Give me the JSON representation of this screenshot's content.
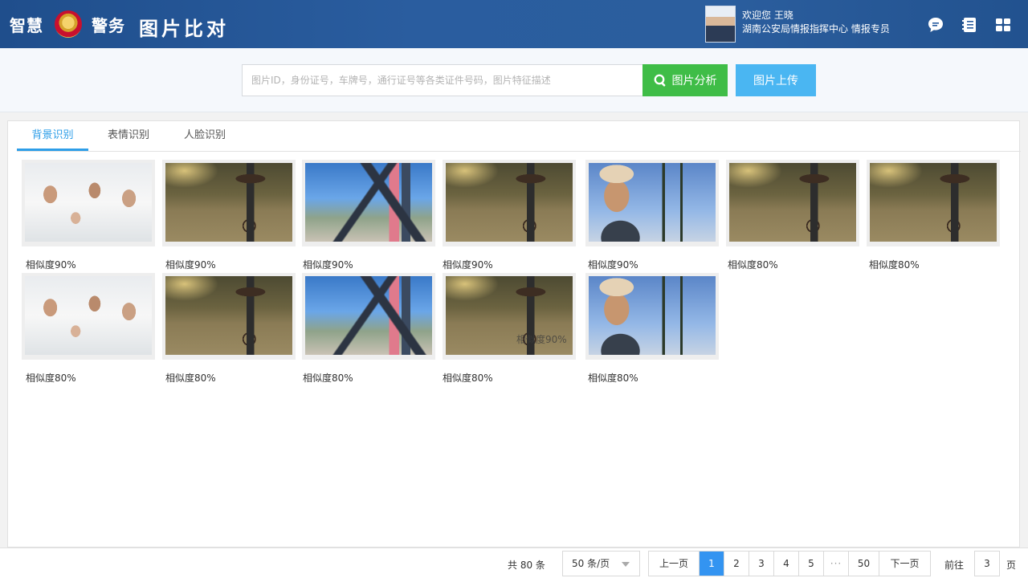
{
  "header": {
    "brand_left": "智慧",
    "brand_right": "警务",
    "app_title": "图片比对",
    "user_greeting": "欢迎您 王晓",
    "user_org": "湖南公安局情报指挥中心 情报专员",
    "icons": [
      "chat-icon",
      "notebook-icon",
      "apps-grid-icon"
    ]
  },
  "search": {
    "placeholder": "图片ID，身份证号，车牌号，通行证号等各类证件号码，图片特征描述",
    "value": "",
    "analyze_label": "图片分析",
    "upload_label": "图片上传"
  },
  "tabs": [
    {
      "label": "背景识别",
      "active": true
    },
    {
      "label": "表情识别",
      "active": false
    },
    {
      "label": "人脸识别",
      "active": false
    }
  ],
  "results": [
    {
      "image": "party-crowd",
      "similarity": "相似度90%"
    },
    {
      "image": "rain-umbrella-bike",
      "similarity": "相似度90%"
    },
    {
      "image": "bridge-couple",
      "similarity": "相似度90%"
    },
    {
      "image": "rain-umbrella-bike",
      "similarity": "相似度90%"
    },
    {
      "image": "man-straw-hat",
      "similarity": "相似度90%"
    },
    {
      "image": "rain-umbrella-bike",
      "similarity": "相似度80%"
    },
    {
      "image": "rain-umbrella-bike",
      "similarity": "相似度80%"
    },
    {
      "image": "party-crowd",
      "similarity": "相似度80%"
    },
    {
      "image": "rain-umbrella-bike",
      "similarity": "相似度80%"
    },
    {
      "image": "bridge-couple",
      "similarity": "相似度80%"
    },
    {
      "image": "rain-umbrella-bike",
      "similarity": "相似度80%",
      "overlay": "相似度90%"
    },
    {
      "image": "man-straw-hat",
      "similarity": "相似度80%"
    }
  ],
  "pagination": {
    "total": "共 80 条",
    "page_size": "50 条/页",
    "prev_label": "上一页",
    "next_label": "下一页",
    "pages": [
      "1",
      "2",
      "3",
      "4",
      "5",
      "···",
      "50"
    ],
    "current_page": "1",
    "goto_label": "前往",
    "goto_value": "3",
    "goto_suffix": "页"
  },
  "colors": {
    "header_bg": "#2a5d9f",
    "analyze_button": "#3fbd47",
    "upload_button": "#4ab6f2",
    "active_tab": "#2e9ee8",
    "active_page": "#3394f1"
  }
}
